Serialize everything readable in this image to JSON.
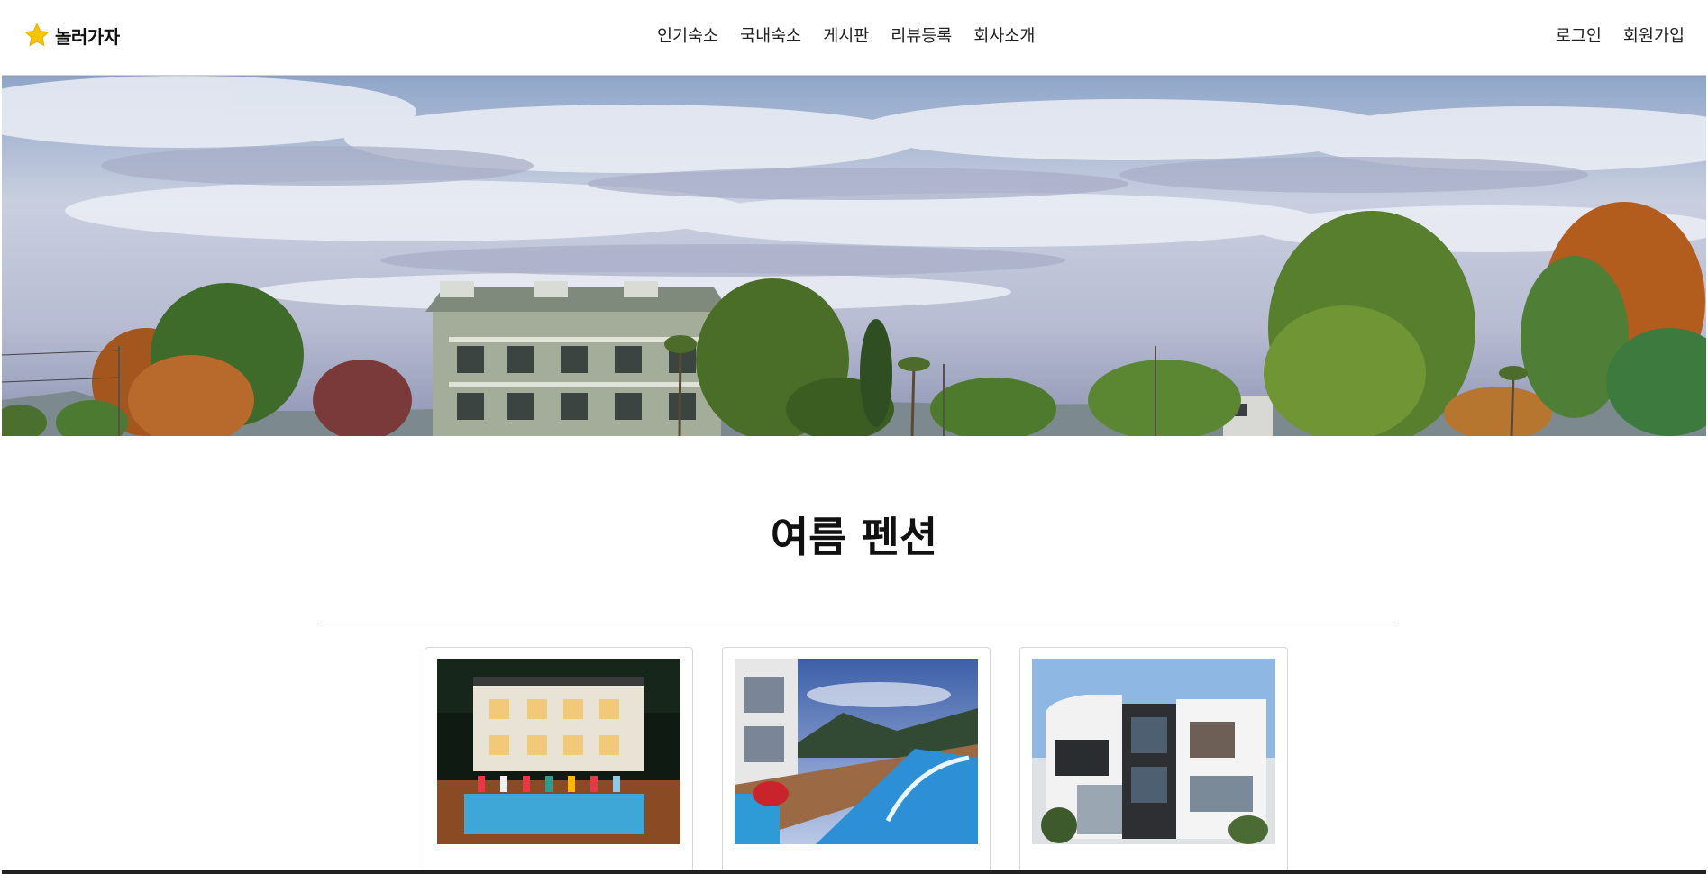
{
  "header": {
    "brand": "놀러가자",
    "nav": [
      "인기숙소",
      "국내숙소",
      "게시판",
      "리뷰등록",
      "회사소개"
    ],
    "auth": {
      "login": "로그인",
      "signup": "회원가입"
    }
  },
  "icons": {
    "logo": "star-icon",
    "logo_color": "#f5c400"
  },
  "section": {
    "title": "여름 펜션"
  },
  "cards": [
    {
      "name": "",
      "image": "night-pool-villa-photo"
    },
    {
      "name": "",
      "image": "infinity-pool-photo"
    },
    {
      "name": "",
      "image": "modern-house-photo"
    }
  ]
}
